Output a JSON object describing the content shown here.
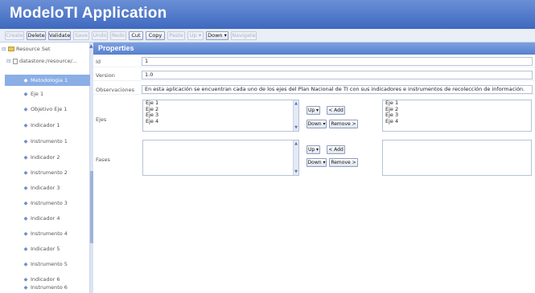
{
  "app": {
    "title": "ModeloTI Application"
  },
  "toolbar": {
    "buttons": [
      {
        "label": "Create",
        "enabled": false
      },
      {
        "label": "Delete",
        "enabled": true
      },
      {
        "label": "Validate",
        "enabled": true
      },
      {
        "label": "Save",
        "enabled": false
      },
      {
        "label": "Undo",
        "enabled": false
      },
      {
        "label": "Redo",
        "enabled": false
      },
      {
        "label": "Cut",
        "enabled": true
      },
      {
        "label": "Copy",
        "enabled": true
      },
      {
        "label": "Paste",
        "enabled": false
      },
      {
        "label": "Up ▾",
        "enabled": false
      },
      {
        "label": "Down ▾",
        "enabled": true
      },
      {
        "label": "Navigate",
        "enabled": false
      }
    ]
  },
  "tree": {
    "items": [
      {
        "label": "Resource Set",
        "icon": "folder-icon"
      },
      {
        "label": "datastore:/resource/...",
        "icon": "document-icon"
      },
      {
        "label": "Metodologia 1",
        "icon": "diamond-icon",
        "selected": true
      },
      {
        "label": "Eje 1",
        "icon": "diamond-icon"
      },
      {
        "label": "Objetivo Eje 1",
        "icon": "diamond-icon"
      },
      {
        "label": "Indicador 1",
        "icon": "diamond-icon"
      },
      {
        "label": "Instrumento 1",
        "icon": "diamond-icon"
      },
      {
        "label": "Indicador 2",
        "icon": "diamond-icon"
      },
      {
        "label": "Instrumento 2",
        "icon": "diamond-icon"
      },
      {
        "label": "Indicador 3",
        "icon": "diamond-icon"
      },
      {
        "label": "Instrumento 3",
        "icon": "diamond-icon"
      },
      {
        "label": "Indicador 4",
        "icon": "diamond-icon"
      },
      {
        "label": "Instrumento 4",
        "icon": "diamond-icon"
      },
      {
        "label": "Indicador 5",
        "icon": "diamond-icon"
      },
      {
        "label": "Instrumento 5",
        "icon": "diamond-icon"
      },
      {
        "label": "Indicador 6",
        "icon": "diamond-icon"
      },
      {
        "label": "Instrumento 6",
        "icon": "diamond-icon"
      }
    ]
  },
  "properties": {
    "header": "Properties",
    "id": {
      "label": "Id",
      "value": "1"
    },
    "version": {
      "label": "Version",
      "value": "1.0"
    },
    "observaciones": {
      "label": "Observaciones",
      "value": "En esta aplicación se encuentran cada uno de los ejes del Plan Nacional de TI con sus indicadores e instrumentos de recolección de información."
    },
    "ejes": {
      "label": "Ejes",
      "available": [
        "Eje 1",
        "Eje 2",
        "Eje 3",
        "Eje 4"
      ],
      "selected": [
        "Eje 1",
        "Eje 2",
        "Eje 3",
        "Eje 4"
      ],
      "up_label": "Up ▾",
      "down_label": "Down ▾",
      "add_label": "< Add",
      "remove_label": "Remove >"
    },
    "fases": {
      "label": "Fases",
      "available": [],
      "selected": [],
      "up_label": "Up ▾",
      "down_label": "Down ▾",
      "add_label": "< Add",
      "remove_label": "Remove >"
    }
  }
}
